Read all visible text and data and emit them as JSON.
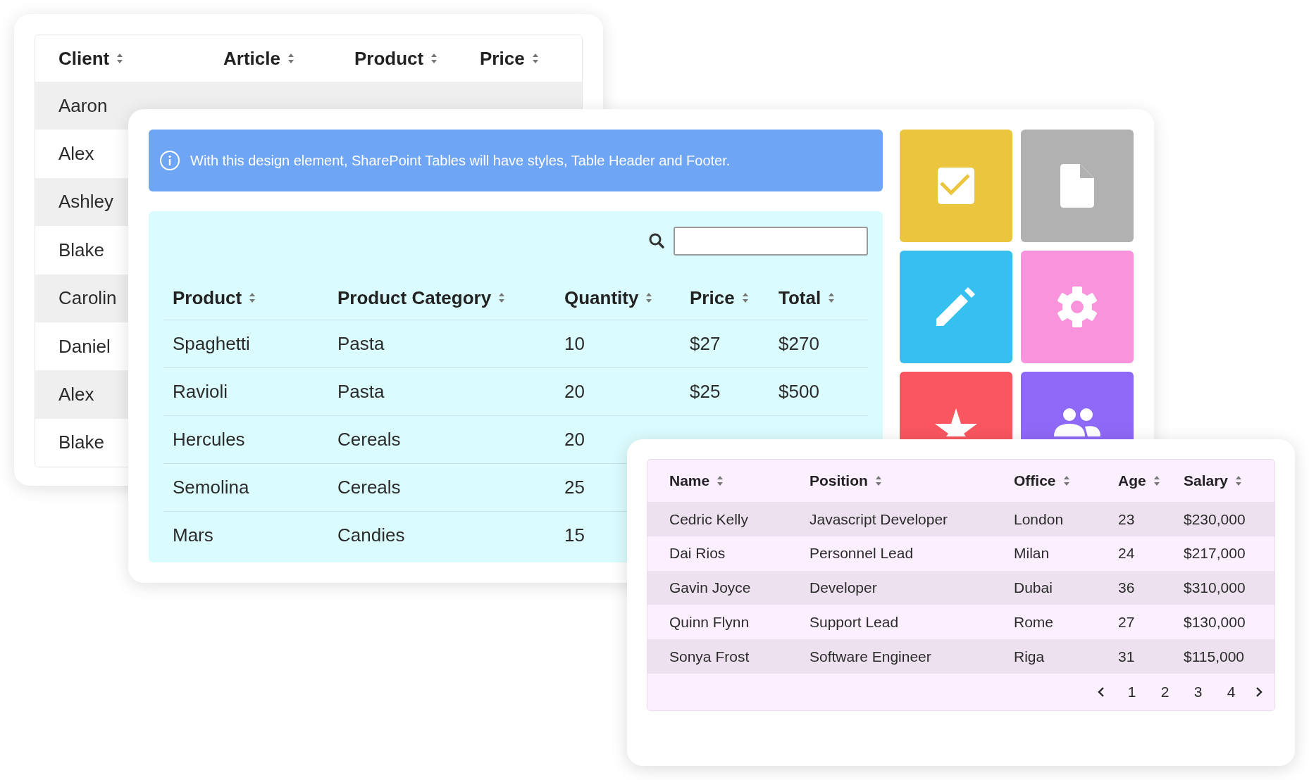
{
  "back_table": {
    "columns": [
      "Client",
      "Article",
      "Product",
      "Price"
    ],
    "rows": [
      {
        "cells": [
          "Aaron"
        ]
      },
      {
        "cells": [
          "Alex"
        ]
      },
      {
        "cells": [
          "Ashley"
        ]
      },
      {
        "cells": [
          "Blake"
        ]
      },
      {
        "cells": [
          "Carolin"
        ]
      },
      {
        "cells": [
          "Daniel"
        ]
      },
      {
        "cells": [
          "Alex"
        ]
      },
      {
        "cells": [
          "Blake"
        ]
      }
    ]
  },
  "info_banner": {
    "text": "With this design element, SharePoint Tables will have styles, Table Header and Footer."
  },
  "product_table": {
    "columns": [
      "Product",
      "Product Category",
      "Quantity",
      "Price",
      "Total"
    ],
    "rows": [
      {
        "cells": [
          "Spaghetti",
          "Pasta",
          "10",
          "$27",
          "$270"
        ]
      },
      {
        "cells": [
          "Ravioli",
          "Pasta",
          "20",
          "$25",
          "$500"
        ]
      },
      {
        "cells": [
          "Hercules",
          "Cereals",
          "20"
        ]
      },
      {
        "cells": [
          "Semolina",
          "Cereals",
          "25"
        ]
      },
      {
        "cells": [
          "Mars",
          "Candies",
          "15"
        ]
      }
    ]
  },
  "tiles": [
    {
      "kind": "check",
      "color": "#ebc53d"
    },
    {
      "kind": "file",
      "color": "#b1b1b1"
    },
    {
      "kind": "pencil",
      "color": "#35c0ef"
    },
    {
      "kind": "gear",
      "color": "#f993dc"
    },
    {
      "kind": "star",
      "color": "#f9565f"
    },
    {
      "kind": "people",
      "color": "#8e69f7"
    }
  ],
  "staff_table": {
    "columns": [
      "Name",
      "Position",
      "Office",
      "Age",
      "Salary"
    ],
    "rows": [
      {
        "cells": [
          "Cedric Kelly",
          "Javascript Developer",
          "London",
          "23",
          "$230,000"
        ]
      },
      {
        "cells": [
          "Dai Rios",
          "Personnel Lead",
          "Milan",
          "24",
          "$217,000"
        ]
      },
      {
        "cells": [
          "Gavin Joyce",
          "Developer",
          "Dubai",
          "36",
          "$310,000"
        ]
      },
      {
        "cells": [
          "Quinn Flynn",
          "Support Lead",
          "Rome",
          "27",
          "$130,000"
        ]
      },
      {
        "cells": [
          "Sonya Frost",
          "Software Engineer",
          "Riga",
          "31",
          "$115,000"
        ]
      }
    ],
    "pagination": {
      "pages": [
        "1",
        "2",
        "3",
        "4"
      ]
    }
  }
}
